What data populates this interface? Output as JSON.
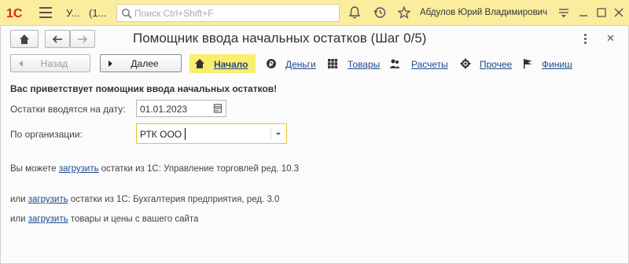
{
  "titlebar": {
    "logo_text": "1С",
    "app_title": "У...",
    "window_count": "(1...",
    "search_placeholder": "Поиск Ctrl+Shift+F",
    "user_name": "Абдулов Юрий Владимирович",
    "bg_color": "#fbed9e"
  },
  "form": {
    "title": "Помощник ввода начальных остатков (Шаг 0/5)",
    "back_label": "Назад",
    "next_label": "Далее",
    "steps": [
      {
        "label": "Начало",
        "icon": "home-icon",
        "active": true
      },
      {
        "label": "Деньги",
        "icon": "coin-icon",
        "active": false
      },
      {
        "label": "Товары",
        "icon": "grid-icon",
        "active": false
      },
      {
        "label": "Расчеты",
        "icon": "people-icon",
        "active": false
      },
      {
        "label": "Прочее",
        "icon": "gear-icon",
        "active": false
      },
      {
        "label": "Финиш",
        "icon": "flag-icon",
        "active": false
      }
    ],
    "welcome": "Вас приветствует помощник ввода начальных остатков!",
    "date_label": "Остатки вводятся на дату:",
    "date_value": "01.01.2023",
    "org_label": "По организации:",
    "org_value": "РТК ООО",
    "para1_prefix": "Вы можете ",
    "para1_link": "загрузить",
    "para1_suffix": " остатки из 1С: Управление торговлей ред. 10.3",
    "para2_prefix": "или ",
    "para2_link": "загрузить",
    "para2_suffix": " остатки из 1С: Бухгалтерия предприятия, ред. 3.0",
    "para3_prefix": "или ",
    "para3_link": "загрузить",
    "para3_suffix": " товары и цены с вашего сайта",
    "accent_color": "#fbed6d",
    "link_color": "#1d4a8a"
  }
}
